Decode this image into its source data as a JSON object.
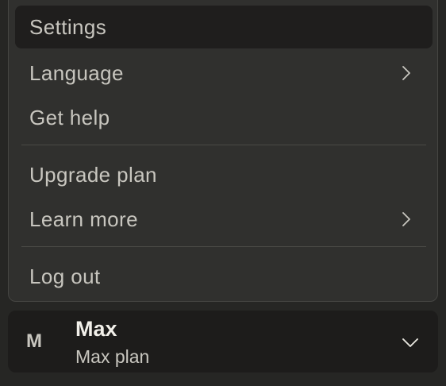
{
  "menu": {
    "items": [
      {
        "label": "Settings",
        "active": true,
        "submenu": false
      },
      {
        "label": "Language",
        "active": false,
        "submenu": true
      },
      {
        "label": "Get help",
        "active": false,
        "submenu": false
      },
      {
        "label": "Upgrade plan",
        "active": false,
        "submenu": false
      },
      {
        "label": "Learn more",
        "active": false,
        "submenu": true
      },
      {
        "label": "Log out",
        "active": false,
        "submenu": false
      }
    ]
  },
  "account": {
    "initial": "M",
    "name": "Max",
    "plan": "Max plan"
  },
  "colors": {
    "background": "#262624",
    "menu_bg": "#30302e",
    "active_bg": "#1f1e1d",
    "account_bg": "#1d1c1b",
    "text": "#c8c6bf",
    "text_strong": "#f2f0ea"
  },
  "icons": {
    "submenu": "chevron-right-icon",
    "account_toggle": "chevron-down-icon"
  }
}
